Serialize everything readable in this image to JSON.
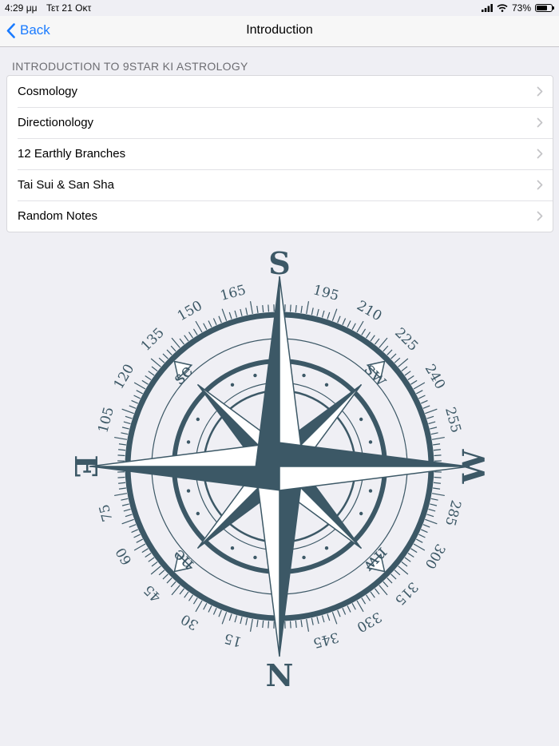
{
  "status": {
    "time": "4:29 μμ",
    "date": "Τετ 21 Οκτ",
    "battery": "73%",
    "battery_level": 0.73
  },
  "nav": {
    "back_label": "Back",
    "title": "Introduction"
  },
  "section": {
    "header": "INTRODUCTION TO 9STAR KI ASTROLOGY"
  },
  "list": {
    "items": [
      {
        "label": "Cosmology"
      },
      {
        "label": "Directionology"
      },
      {
        "label": "12 Earthly Branches"
      },
      {
        "label": "Tai Sui & San Sha"
      },
      {
        "label": "Random Notes"
      }
    ]
  },
  "compass": {
    "cardinals": {
      "north": "N",
      "south": "S",
      "east": "E",
      "west": "W"
    },
    "intercardinals": {
      "se": "se",
      "sw": "sw",
      "ne": "ne",
      "nw": "nw"
    },
    "degree_labels": [
      "15",
      "30",
      "45",
      "60",
      "75",
      "105",
      "120",
      "135",
      "150",
      "165",
      "195",
      "210",
      "225",
      "240",
      "255",
      "285",
      "300",
      "315",
      "330",
      "345"
    ],
    "colors": {
      "primary": "#3c5866",
      "light": "#ffffff"
    }
  }
}
